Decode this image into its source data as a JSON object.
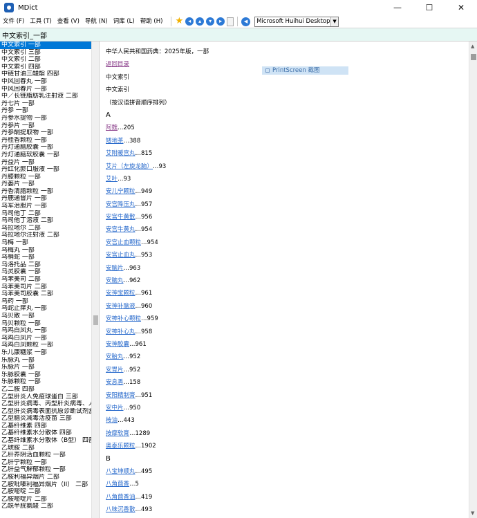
{
  "window": {
    "title": "MDict",
    "minimize": "—",
    "maximize": "☐",
    "close": "✕"
  },
  "menu": [
    "文件 (F)",
    "工具 (T)",
    "查看 (V)",
    "导航 (N)",
    "词库 (L)",
    "帮助 (H)"
  ],
  "toolbar": {
    "voice": "Microsoft Huihui Desktop -"
  },
  "search": {
    "value": "中文索引_一部"
  },
  "word_list": [
    "中文索引 一部",
    "中文索引 三部",
    "中文索引 二部",
    "中文索引 四部",
    "中链甘油三酸酯 四部",
    "中风回春丸 一部",
    "中风回春片 一部",
    "中／长链脂肪乳注射液 二部",
    "丹七片 一部",
    "丹参 一部",
    "丹参水提物 一部",
    "丹参片 一部",
    "丹参酮提取物 一部",
    "丹桂香颗粒 一部",
    "丹灯通脑胶囊 一部",
    "丹灯通脑软胶囊 一部",
    "丹益片 一部",
    "丹红化瘀口服液 一部",
    "丹膝颗粒 一部",
    "丹蒌片 一部",
    "丹香清脂颗粒 一部",
    "丹鹿通督片 一部",
    "乌军治胆片 一部",
    "乌司他丁 二部",
    "乌司他丁溶液 二部",
    "乌拉地尔 二部",
    "乌拉地尔注射液 二部",
    "乌梅 一部",
    "乌梅丸 一部",
    "乌梢蛇 一部",
    "乌洛托品 二部",
    "乌灵胶囊 一部",
    "乌苯美司 二部",
    "乌苯美司片 二部",
    "乌苯美司胶囊 二部",
    "乌药 一部",
    "乌蛇止痒丸 一部",
    "乌贝散 一部",
    "乌贝颗粒 一部",
    "乌鸡白凤丸 一部",
    "乌鸡白凤片 一部",
    "乌鸡白凤颗粒 一部",
    "乐儿康糖浆 一部",
    "乐脉丸 一部",
    "乐脉片 一部",
    "乐脉胶囊 一部",
    "乐脉颗粒 一部",
    "乙二胺 四部",
    "乙型肝炎人免疫球蛋白 三部",
    "乙型肝炎病毒、丙型肝炎病毒、人",
    "乙型肝炎病毒表面抗原诊断试剂盒",
    "乙型脑炎减毒活疫苗 三部",
    "乙基纤维素 四部",
    "乙基纤维素水分散体 四部",
    "乙基纤维素水分散体（B型） 四部",
    "乙琥胺 二部",
    "乙肝养阴活血颗粒 一部",
    "乙肝宁颗粒 一部",
    "乙肝益气解郁颗粒 一部",
    "乙胺利福异烟片 二部",
    "乙胺吡嗪利福异烟片（II） 二部",
    "乙胺嘧啶 二部",
    "乙胺嘧啶片 二部",
    "乙酰半胱氨酸 二部"
  ],
  "content": {
    "heading": "中华人民共和国药典：2025年版，一部",
    "back_link": "返回目录",
    "index_title1": "中文索引",
    "index_title2": "中文索引",
    "note": "（按汉语拼音顺序排列）",
    "section_a": "A",
    "section_b": "B",
    "entries_a": [
      {
        "name": "阿魏",
        "page": "205",
        "visited": true
      },
      {
        "name": "矮地茶",
        "page": "388"
      },
      {
        "name": "艾附暖宫丸",
        "page": "815"
      },
      {
        "name": "艾片（左旋龙脑）",
        "page": "93"
      },
      {
        "name": "艾叶",
        "page": "93"
      },
      {
        "name": "安儿宁颗粒",
        "page": "949"
      },
      {
        "name": "安宫降压丸",
        "page": "957"
      },
      {
        "name": "安宫牛黄散",
        "page": "956"
      },
      {
        "name": "安宫牛黄丸",
        "page": "954"
      },
      {
        "name": "安宫止血颗粒",
        "page": "954"
      },
      {
        "name": "安宫止血丸",
        "page": "953"
      },
      {
        "name": "安脑片",
        "page": "963"
      },
      {
        "name": "安脑丸",
        "page": "962"
      },
      {
        "name": "安神宝颗粒",
        "page": "961"
      },
      {
        "name": "安神补脑液",
        "page": "960"
      },
      {
        "name": "安神补心颗粒",
        "page": "959"
      },
      {
        "name": "安神补心丸",
        "page": "958"
      },
      {
        "name": "安神胶囊",
        "page": "961"
      },
      {
        "name": "安胎丸",
        "page": "952"
      },
      {
        "name": "安胃片",
        "page": "952"
      },
      {
        "name": "安息香",
        "page": "158"
      },
      {
        "name": "安阳精制膏",
        "page": "951"
      },
      {
        "name": "安中片",
        "page": "950"
      },
      {
        "name": "桉油",
        "page": "443"
      },
      {
        "name": "按摩软膏",
        "page": "1289"
      },
      {
        "name": "奥泰乐颗粒",
        "page": "1902"
      }
    ],
    "entries_b": [
      {
        "name": "八宝坤顺丸",
        "page": "495"
      },
      {
        "name": "八角茴香",
        "page": "5"
      },
      {
        "name": "八角茴香油",
        "page": "419"
      },
      {
        "name": "八味沉香散",
        "page": "493"
      }
    ]
  },
  "overlay": {
    "label": "PrintScreen 截图"
  }
}
